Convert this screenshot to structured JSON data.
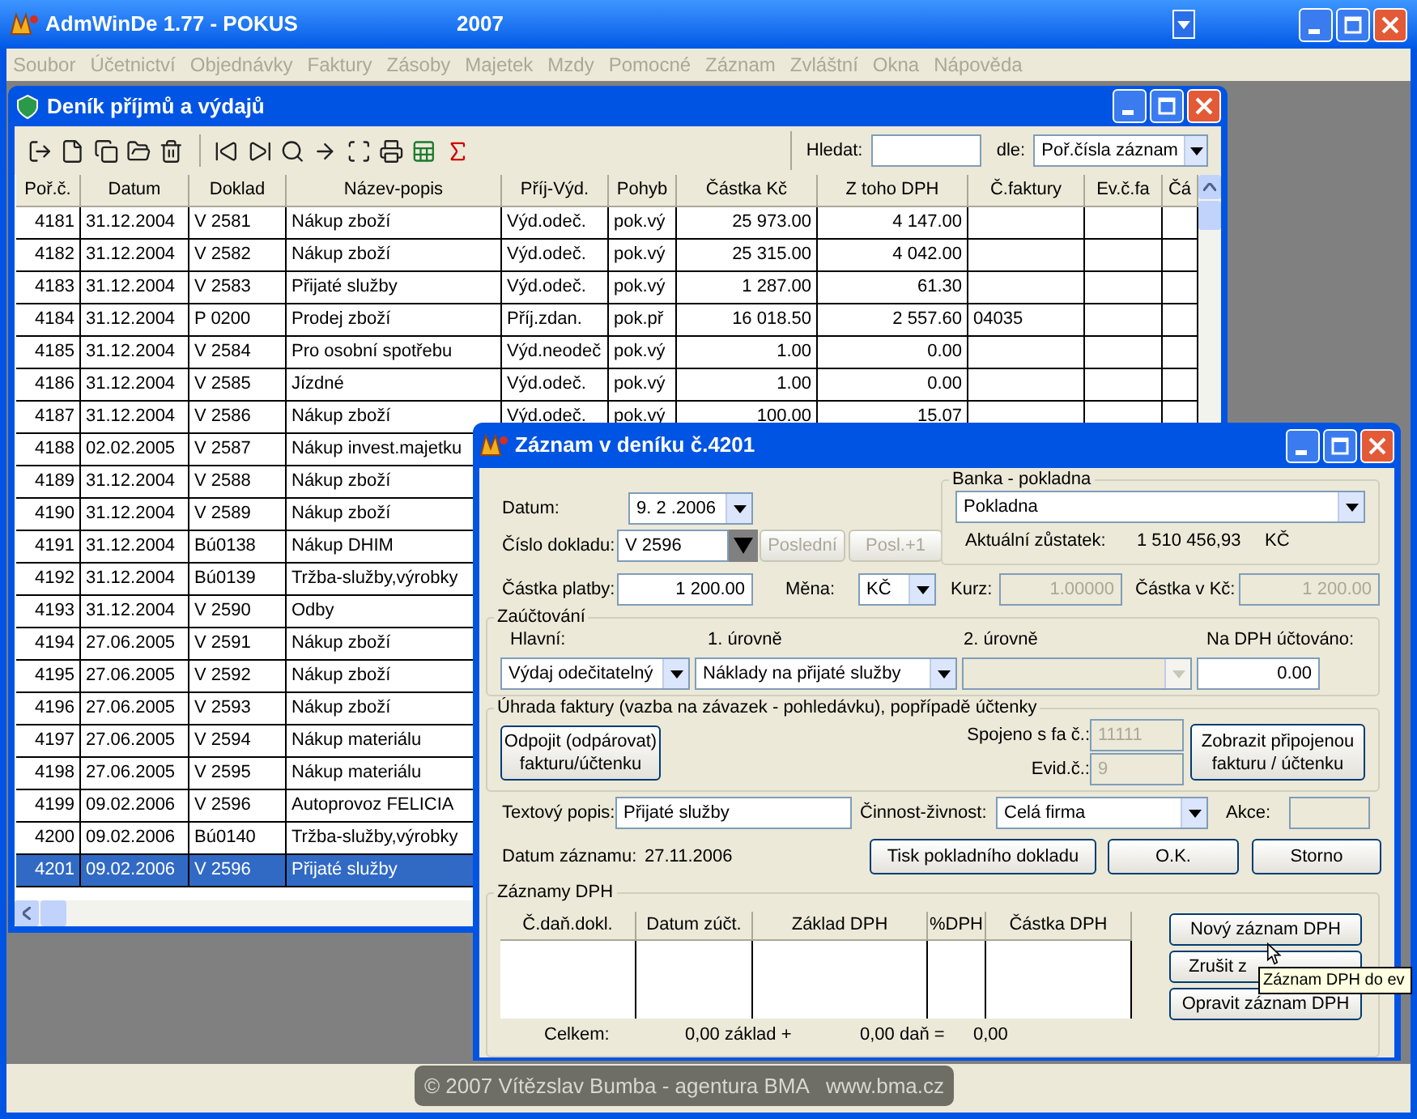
{
  "app": {
    "title": "AdmWinDe 1.77 - POKUS",
    "year": "2007"
  },
  "menu": [
    {
      "label": "Soubor",
      "disabled": true
    },
    {
      "label": "Účetnictví",
      "disabled": true
    },
    {
      "label": "Objednávky",
      "disabled": true
    },
    {
      "label": "Faktury",
      "disabled": true
    },
    {
      "label": "Zásoby",
      "disabled": true
    },
    {
      "label": "Majetek",
      "disabled": true
    },
    {
      "label": "Mzdy",
      "disabled": true
    },
    {
      "label": "Pomocné",
      "disabled": true
    },
    {
      "label": "Záznam",
      "disabled": true
    },
    {
      "label": "Zvláštní",
      "disabled": true
    },
    {
      "label": "Okna",
      "disabled": true
    },
    {
      "label": "Nápověda",
      "disabled": true
    }
  ],
  "journal": {
    "title": "Deník příjmů a výdajů",
    "search_label": "Hledat:",
    "sort_label": "dle:",
    "sort_value": "Poř.čísla záznam",
    "columns": [
      "Poř.č.",
      "Datum",
      "Doklad",
      "Název-popis",
      "Příj-Výd.",
      "Pohyb",
      "Částka Kč",
      "Z toho DPH",
      "Č.faktury",
      "Ev.č.fa",
      "Čá"
    ],
    "rows": [
      {
        "selected": false,
        "cells": [
          "4181",
          "31.12.2004",
          "V 2581",
          "Nákup zboží",
          "Výd.odeč.",
          "pok.vý",
          "25 973.00",
          "4 147.00"
        ]
      },
      {
        "selected": false,
        "cells": [
          "4182",
          "31.12.2004",
          "V 2582",
          "Nákup zboží",
          "Výd.odeč.",
          "pok.vý",
          "25 315.00",
          "4 042.00"
        ]
      },
      {
        "selected": false,
        "cells": [
          "4183",
          "31.12.2004",
          "V 2583",
          "Přijaté služby",
          "Výd.odeč.",
          "pok.vý",
          "1 287.00",
          "61.30"
        ]
      },
      {
        "selected": false,
        "cells": [
          "4184",
          "31.12.2004",
          "P 0200",
          "Prodej zboží",
          "Příj.zdan.",
          "pok.př",
          "16 018.50",
          "2 557.60",
          "04035"
        ]
      },
      {
        "selected": false,
        "cells": [
          "4185",
          "31.12.2004",
          "V 2584",
          "Pro osobní spotřebu",
          "Výd.neodeč",
          "pok.vý",
          "1.00",
          "0.00"
        ]
      },
      {
        "selected": false,
        "cells": [
          "4186",
          "31.12.2004",
          "V 2585",
          "Jízdné",
          "Výd.odeč.",
          "pok.vý",
          "1.00",
          "0.00"
        ]
      },
      {
        "selected": false,
        "cells": [
          "4187",
          "31.12.2004",
          "V 2586",
          "Nákup zboží",
          "Výd.odeč.",
          "pok.vý",
          "100.00",
          "15.07"
        ]
      },
      {
        "selected": false,
        "cells": [
          "4188",
          "02.02.2005",
          "V 2587",
          "Nákup invest.majetku"
        ]
      },
      {
        "selected": false,
        "cells": [
          "4189",
          "31.12.2004",
          "V 2588",
          "Nákup zboží"
        ]
      },
      {
        "selected": false,
        "cells": [
          "4190",
          "31.12.2004",
          "V 2589",
          "Nákup zboží"
        ]
      },
      {
        "selected": false,
        "cells": [
          "4191",
          "31.12.2004",
          "Bú0138",
          "Nákup DHIM"
        ]
      },
      {
        "selected": false,
        "cells": [
          "4192",
          "31.12.2004",
          "Bú0139",
          "Tržba-služby,výrobky"
        ]
      },
      {
        "selected": false,
        "cells": [
          "4193",
          "31.12.2004",
          "V 2590",
          "Odby"
        ]
      },
      {
        "selected": false,
        "cells": [
          "4194",
          "27.06.2005",
          "V 2591",
          "Nákup zboží"
        ]
      },
      {
        "selected": false,
        "cells": [
          "4195",
          "27.06.2005",
          "V 2592",
          "Nákup zboží"
        ]
      },
      {
        "selected": false,
        "cells": [
          "4196",
          "27.06.2005",
          "V 2593",
          "Nákup zboží"
        ]
      },
      {
        "selected": false,
        "cells": [
          "4197",
          "27.06.2005",
          "V 2594",
          "Nákup materiálu"
        ]
      },
      {
        "selected": false,
        "cells": [
          "4198",
          "27.06.2005",
          "V 2595",
          "Nákup materiálu"
        ]
      },
      {
        "selected": false,
        "cells": [
          "4199",
          "09.02.2006",
          "V 2596",
          "Autoprovoz FELICIA"
        ]
      },
      {
        "selected": false,
        "cells": [
          "4200",
          "09.02.2006",
          "Bú0140",
          "Tržba-služby,výrobky"
        ]
      },
      {
        "selected": true,
        "cells": [
          "4201",
          "09.02.2006",
          "V 2596",
          "Přijaté služby"
        ]
      }
    ]
  },
  "dialog": {
    "title": "Záznam v deníku č.4201",
    "date": {
      "label": "Datum:",
      "value": "9. 2 .2006"
    },
    "doc_number": {
      "label": "Číslo dokladu:",
      "value": "V 2596"
    },
    "doc_buttons": [
      {
        "label": "Poslední",
        "disabled": true
      },
      {
        "label": "Posl.+1",
        "disabled": true
      }
    ],
    "bank": {
      "legend": "Banka - pokladna",
      "value": "Pokladna",
      "balance_label": "Aktuální zůstatek:",
      "balance": "1 510 456,93",
      "currency": "KČ"
    },
    "amount": {
      "label": "Částka platby:",
      "value": "1 200.00"
    },
    "currency": {
      "label": "Měna:",
      "value": "KČ"
    },
    "rate": {
      "label": "Kurz:",
      "value": "1.00000",
      "disabled": true
    },
    "amount_czk": {
      "label": "Částka v Kč:",
      "value": "1 200.00",
      "disabled": true
    },
    "posting": {
      "legend": "Zaúčtování",
      "main_label": "Hlavní:",
      "level1_label": "1. úrovně",
      "level2_label": "2. úrovně",
      "vat_label": "Na DPH účtováno:",
      "main": "Výdaj odečitatelný",
      "level1": "Náklady na přijaté služby",
      "level2_disabled": true,
      "vat": "0.00"
    },
    "invoice": {
      "legend": "Úhrada faktury (vazba na závazek - pohledávku), popřípadě účtenky",
      "unlink_button": [
        "Odpojit (odpárovat)",
        "fakturu/účtenku"
      ],
      "linked_label": "Spojeno s fa č.:",
      "linked": "11111",
      "evid_label": "Evid.č.:",
      "evid": "9",
      "disabled": true,
      "show_button": [
        "Zobrazit připojenou",
        "fakturu / účtenku"
      ]
    },
    "description": {
      "label": "Textový popis:",
      "value": "Přijaté služby"
    },
    "activity": {
      "label": "Činnost-živnost:",
      "value": "Celá firma"
    },
    "action": {
      "label": "Akce:"
    },
    "record_date": {
      "label": "Datum záznamu:",
      "value": "27.11.2006"
    },
    "buttons": [
      "Tisk pokladního dokladu",
      "O.K.",
      "Storno"
    ],
    "vat": {
      "legend": "Záznamy DPH",
      "columns": [
        "Č.daň.dokl.",
        "Datum zúčt.",
        "Základ DPH",
        "%DPH",
        "Částka DPH"
      ],
      "total_label": "Celkem:",
      "base": "0,00 základ  +",
      "tax": "0,00 daň  =",
      "sum": "0,00",
      "buttons": [
        "Nový záznam DPH",
        "Zrušit z",
        "Opravit záznam DPH"
      ]
    }
  },
  "tooltip": "Záznam DPH do ev",
  "footer": "© 2007 Vítězslav Bumba - agentura BMA   www.bma.cz"
}
